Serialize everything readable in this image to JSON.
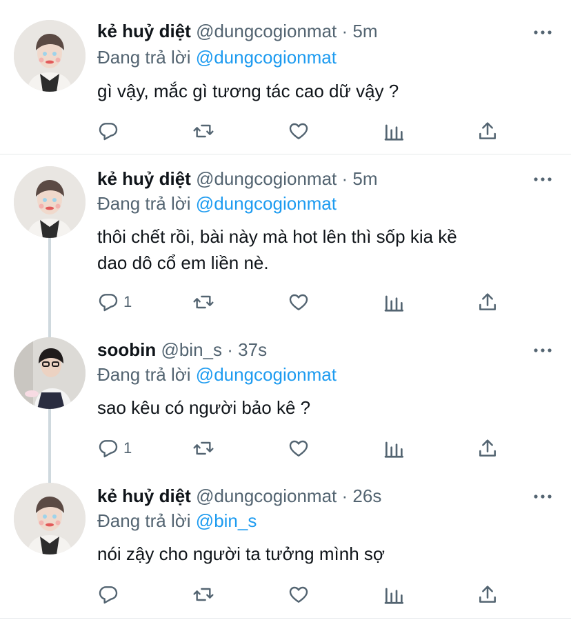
{
  "tweets": [
    {
      "name": "kẻ huỷ diệt",
      "handle": "@dungcogionmat",
      "sep": "·",
      "time": "5m",
      "replying_prefix": "Đang trả lời",
      "replying_to": "@dungcogionmat",
      "text": "gì vậy, mắc gì tương tác cao dữ vậy ?",
      "reply_count": ""
    },
    {
      "name": "kẻ huỷ diệt",
      "handle": "@dungcogionmat",
      "sep": "·",
      "time": "5m",
      "replying_prefix": "Đang trả lời",
      "replying_to": "@dungcogionmat",
      "text_line1": "thôi chết rồi, bài này mà hot lên thì sốp kia kề",
      "text_line2": "dao dô cổ em liền nè.",
      "reply_count": "1"
    },
    {
      "name": "soobin",
      "handle": "@bin_s",
      "sep": "·",
      "time": "37s",
      "replying_prefix": "Đang trả lời",
      "replying_to": "@dungcogionmat",
      "text": "sao kêu có người bảo kê ?",
      "reply_count": "1"
    },
    {
      "name": "kẻ huỷ diệt",
      "handle": "@dungcogionmat",
      "sep": "·",
      "time": "26s",
      "replying_prefix": "Đang trả lời",
      "replying_to": "@bin_s",
      "text": "nói zậy cho người ta tưởng mình sợ",
      "reply_count": ""
    }
  ],
  "colors": {
    "accent": "#1d9bf0",
    "secondary": "#536471",
    "text": "#0f1419",
    "divider": "#e6e9eb",
    "thread_line": "#cfd9de"
  },
  "icons": [
    "reply-icon",
    "retweet-icon",
    "like-icon",
    "analytics-icon",
    "share-icon",
    "more-icon"
  ]
}
